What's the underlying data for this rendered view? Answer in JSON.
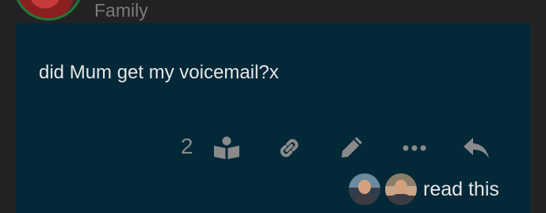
{
  "group": {
    "name": "Family"
  },
  "post": {
    "text": "did Mum get my voicemail?x"
  },
  "actions": {
    "read_count": "2",
    "icons": [
      "book-open-icon",
      "link-icon",
      "pencil-icon",
      "ellipsis-icon",
      "reply-icon"
    ]
  },
  "readers": {
    "label": "read this",
    "count": 2
  },
  "colors": {
    "background": "#222222",
    "card": "#032838",
    "icon": "#8a8a8a",
    "text": "#e6e6e6",
    "muted": "#7b7b7b"
  }
}
